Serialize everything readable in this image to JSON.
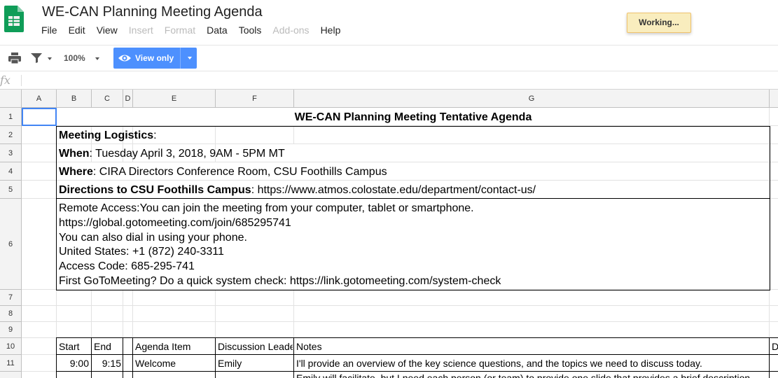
{
  "app": {
    "document_title": "WE-CAN Planning Meeting Agenda",
    "status_badge": "Working...",
    "menu": [
      {
        "label": "File",
        "enabled": true
      },
      {
        "label": "Edit",
        "enabled": true
      },
      {
        "label": "View",
        "enabled": true
      },
      {
        "label": "Insert",
        "enabled": false
      },
      {
        "label": "Format",
        "enabled": false
      },
      {
        "label": "Data",
        "enabled": true
      },
      {
        "label": "Tools",
        "enabled": true
      },
      {
        "label": "Add-ons",
        "enabled": false
      },
      {
        "label": "Help",
        "enabled": true
      }
    ]
  },
  "toolbar": {
    "print_icon": "print-icon",
    "filter_icon": "filter-icon",
    "zoom": "100%",
    "view_mode_label": "View only",
    "view_mode_icon": "eye-icon",
    "accent_color": "#4d90fe"
  },
  "formula_bar": {
    "fx_label": "fx",
    "value": ""
  },
  "grid": {
    "columns": [
      "A",
      "B",
      "C",
      "D",
      "E",
      "F",
      "G"
    ],
    "rows": [
      "1",
      "2",
      "3",
      "4",
      "5",
      "6",
      "7",
      "8",
      "9",
      "10",
      "11"
    ],
    "selected_cell": "A1",
    "cells": {
      "title": "WE-CAN Planning Meeting Tentative Agenda",
      "logistics_label": "Meeting Logistics",
      "logistics_suffix": ":",
      "when_label": "When",
      "when_value": ": Tuesday April 3, 2018, 9AM - 5PM MT",
      "where_label": "Where",
      "where_value": ": CIRA Directors Conference Room, CSU Foothills Campus",
      "directions_label": "Directions to CSU Foothills Campus",
      "directions_value": ": https://www.atmos.colostate.edu/department/contact-us/",
      "remote_lines": [
        "Remote Access:You can join the meeting from your computer, tablet or smartphone.",
        "https://global.gotomeeting.com/join/685295741",
        "You can also dial in using your phone.",
        "United States: +1 (872) 240-3311",
        "Access Code: 685-295-741",
        "First GoToMeeting? Do a quick system check: https://link.gotomeeting.com/system-check"
      ]
    },
    "agenda_headers": {
      "start": "Start",
      "end": "End",
      "item": "Agenda Item",
      "leader": "Discussion Leader",
      "notes": "Notes",
      "next": "D"
    },
    "agenda_rows": [
      {
        "start": "9:00",
        "end": "9:15",
        "item": "Welcome",
        "leader": "Emily",
        "notes": "I'll provide an overview of the key science questions, and the topics we need to discuss today."
      }
    ],
    "partial_row_text": "Emily will facilitate, but I need each person (or team) to provide one slide that provides a brief description"
  }
}
